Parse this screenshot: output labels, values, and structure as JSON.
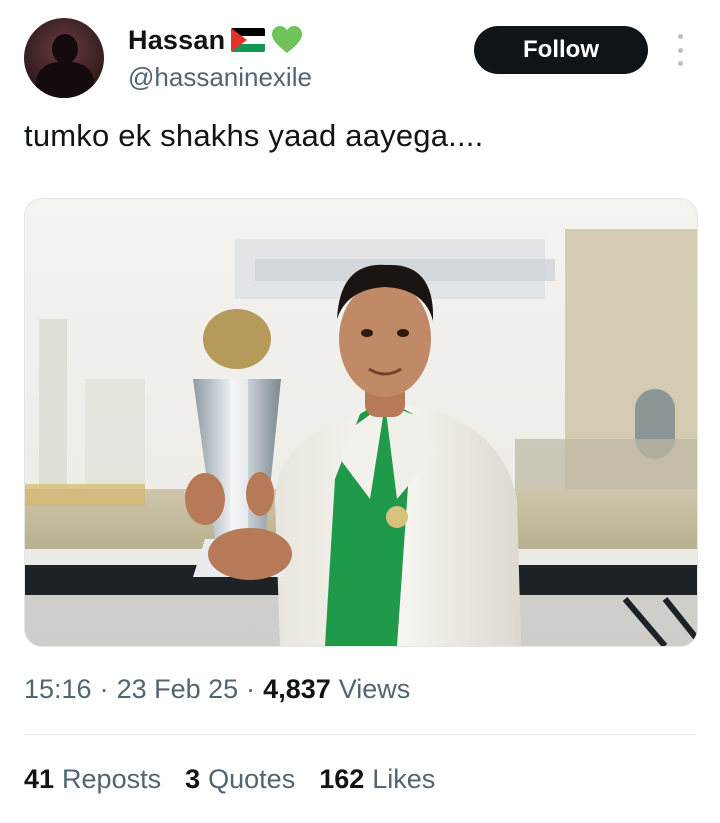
{
  "author": {
    "display_name": "Hassan",
    "handle": "@hassaninexile",
    "badges": [
      "palestine-flag-icon",
      "green-heart-icon"
    ]
  },
  "follow_button": {
    "label": "Follow"
  },
  "tweet": {
    "text": "tumko ek shakhs yaad aayega...."
  },
  "meta": {
    "time": "15:16",
    "date": "23 Feb 25",
    "views_count": "4,837",
    "views_label": "Views"
  },
  "stats": {
    "reposts": {
      "count": "41",
      "label": "Reposts"
    },
    "quotes": {
      "count": "3",
      "label": "Quotes"
    },
    "likes": {
      "count": "162",
      "label": "Likes"
    }
  },
  "colors": {
    "follow_bg": "#0f1419",
    "secondary_text": "#536471",
    "heart": "#6ec45b",
    "jersey_green": "#1f9a4a"
  }
}
